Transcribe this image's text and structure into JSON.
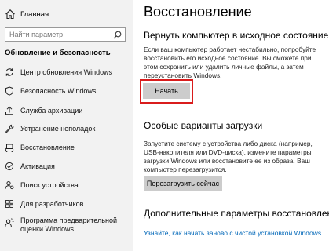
{
  "sidebar": {
    "home_label": "Главная",
    "search_placeholder": "Найти параметр",
    "section_title": "Обновление и безопасность",
    "items": [
      {
        "label": "Центр обновления Windows",
        "icon": "sync-icon"
      },
      {
        "label": "Безопасность Windows",
        "icon": "shield-icon"
      },
      {
        "label": "Служба архивации",
        "icon": "upload-icon"
      },
      {
        "label": "Устранение неполадок",
        "icon": "wrench-icon"
      },
      {
        "label": "Восстановление",
        "icon": "recovery-icon"
      },
      {
        "label": "Активация",
        "icon": "activation-icon"
      },
      {
        "label": "Поиск устройства",
        "icon": "person-pin-icon"
      },
      {
        "label": "Для разработчиков",
        "icon": "developer-icon"
      },
      {
        "label": "Программа предварительной оценки Windows",
        "icon": "insider-icon"
      }
    ]
  },
  "main": {
    "title": "Восстановление",
    "reset": {
      "heading": "Вернуть компьютер в исходное состояние",
      "description": "Если ваш компьютер работает нестабильно, попробуйте восстановить его исходное состояние. Вы сможете при этом сохранить или удалить личные файлы, а затем переустановить Windows.",
      "button_label": "Начать"
    },
    "advanced_startup": {
      "heading": "Особые варианты загрузки",
      "description": "Запустите систему с устройства либо диска (например, USB-накопителя или DVD-диска), измените параметры загрузки Windows или восстановите ее из образа. Ваш компьютер перезагрузится.",
      "button_label": "Перезагрузить сейчас"
    },
    "more_options": {
      "heading": "Дополнительные параметры восстановления",
      "link_label": "Узнайте, как начать заново с чистой установкой Windows"
    }
  },
  "colors": {
    "sidebar_bg": "#f2f2f2",
    "button_bg": "#cccccc",
    "highlight_border": "#d91c1c",
    "link": "#0067b8"
  }
}
